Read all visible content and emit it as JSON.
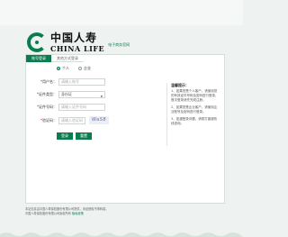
{
  "brand": {
    "name_cn": "中国人寿",
    "name_en": "CHINA LIFE",
    "tagline": "电子商务官网"
  },
  "tabs": [
    {
      "label": "账号登录",
      "active": true
    },
    {
      "label": "其他方式登录",
      "active": false
    }
  ],
  "login_type": {
    "options": [
      "个人",
      "企业"
    ],
    "selected": "个人"
  },
  "form": {
    "account_label": "用户名：",
    "account_placeholder": "请输入账号",
    "id_type_label": "证件类型：",
    "id_type_value": "身份证",
    "id_no_label": "证件号码：",
    "id_no_placeholder": "请输入证件号码",
    "captcha_label": "验证码：",
    "captcha_placeholder": "请输入验证码",
    "captcha_image_text": "WaS8"
  },
  "buttons": {
    "login": "登录",
    "reset": "重置"
  },
  "notice": {
    "title": "温馨提示：",
    "items": [
      "1、如果您是个人客户，请使用您的有效证件号码及密码进行登录，首次登录请先完成注册。",
      "2、如果您是企业客户，请使用企业账号及密码进行登录。",
      "3、如遇登录问题，请拨打客服热线咨询。"
    ]
  },
  "footer": {
    "line1": "本站信息由中国人寿保险股份有限公司提供，未经授权不得转载。",
    "line2": "中国人寿保险股份有限公司版权所有",
    "link": "隐私政策"
  },
  "colors": {
    "brand_green": "#0a7d4f",
    "background": "#eef3f1"
  }
}
